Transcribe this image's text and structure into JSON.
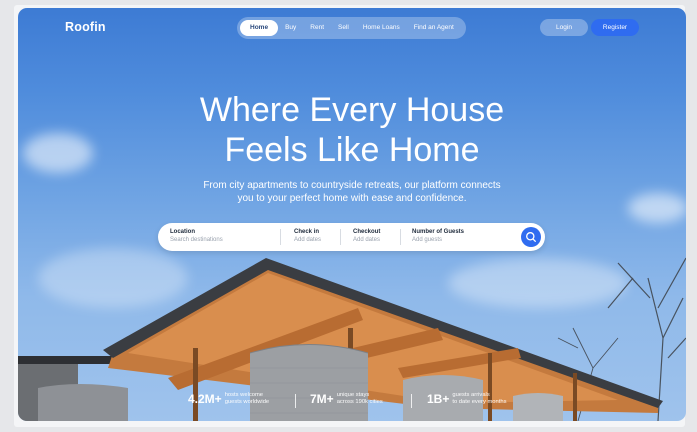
{
  "brand": {
    "logo": "Roofin"
  },
  "nav": {
    "items": [
      {
        "label": "Home",
        "active": true
      },
      {
        "label": "Buy",
        "active": false
      },
      {
        "label": "Rent",
        "active": false
      },
      {
        "label": "Sell",
        "active": false
      },
      {
        "label": "Home Loans",
        "active": false
      },
      {
        "label": "Find an Agent",
        "active": false
      }
    ],
    "login": "Login",
    "register": "Register"
  },
  "hero": {
    "headline_line1": "Where Every House",
    "headline_line2": "Feels Like Home",
    "subtitle_line1": "From city apartments to countryside retreats, our platform connects",
    "subtitle_line2": "you to your perfect home with ease and confidence."
  },
  "search": {
    "location": {
      "label": "Location",
      "placeholder": "Search destinations"
    },
    "checkin": {
      "label": "Check in",
      "placeholder": "Add dates"
    },
    "checkout": {
      "label": "Checkout",
      "placeholder": "Add dates"
    },
    "guests": {
      "label": "Number of Guests",
      "placeholder": "Add guests"
    },
    "button_icon": "search-icon"
  },
  "stats": [
    {
      "value": "4.2M+",
      "line1": "hosts welcome",
      "line2": "guests worldwide"
    },
    {
      "value": "7M+",
      "line1": "unique stays",
      "line2": "across 190k cities"
    },
    {
      "value": "1B+",
      "line1": "guests arrivals",
      "line2": "to date every months"
    }
  ],
  "colors": {
    "accent": "#2f6cf0",
    "sky": "#4f8cdc"
  }
}
